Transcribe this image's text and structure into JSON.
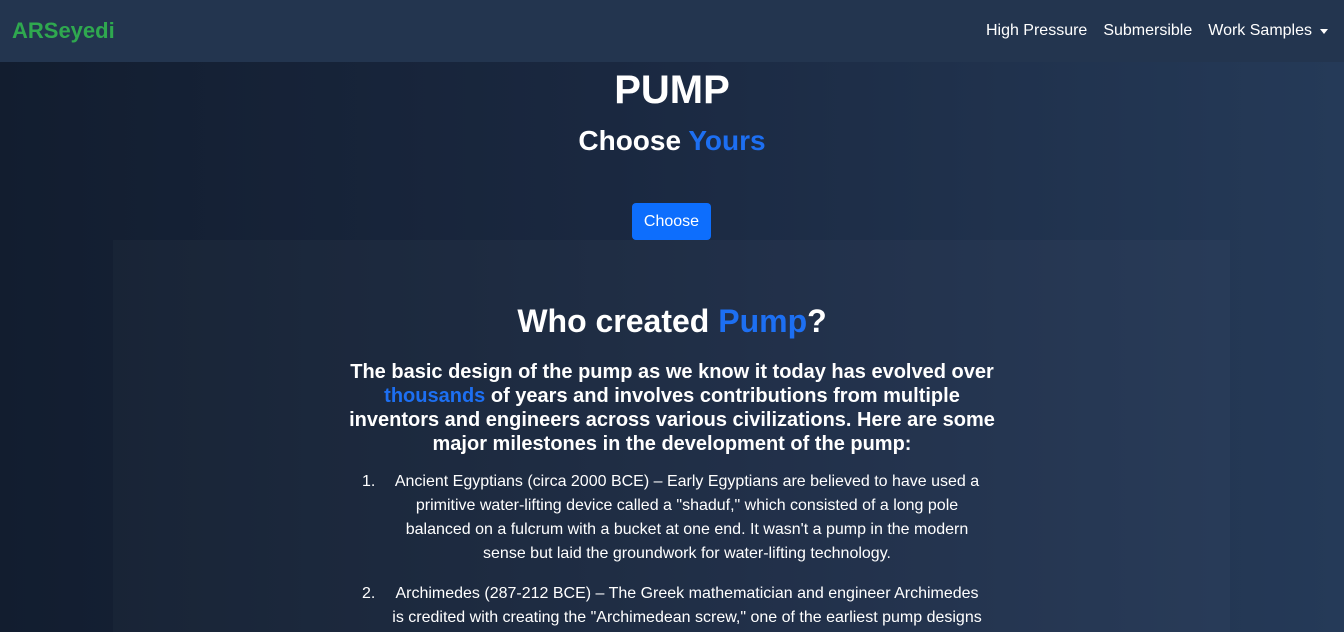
{
  "navbar": {
    "brand": "ARSeyedi",
    "links": [
      "High Pressure",
      "Submersible",
      "Work Samples"
    ]
  },
  "hero": {
    "title": "PUMP",
    "subtitle_prefix": "Choose ",
    "subtitle_accent": "Yours",
    "button_label": "Choose"
  },
  "section": {
    "heading_prefix": "Who created ",
    "heading_accent": "Pump",
    "heading_suffix": "?",
    "intro_prefix": "The basic design of the pump as we know it today has evolved over ",
    "intro_accent": "thousands",
    "intro_suffix": " of years and involves contributions from multiple inventors and engineers across various civilizations. Here are some major milestones in the development of the pump:",
    "milestones": [
      {
        "num": "1.",
        "text": "Ancient Egyptians (circa 2000 BCE) – Early Egyptians are believed to have used a primitive water-lifting device called a \"shaduf,\" which consisted of a long pole balanced on a fulcrum with a bucket at one end. It wasn't a pump in the modern sense but laid the groundwork for water-lifting technology."
      },
      {
        "num": "2.",
        "text": "Archimedes (287-212 BCE) – The Greek mathematician and engineer Archimedes is credited with creating the \"Archimedean screw,\" one of the earliest pump designs"
      }
    ]
  },
  "colors": {
    "accent": "#1d6ff2",
    "brand": "#2fa84f",
    "button": "#0d6efd",
    "navbar": "#23354f"
  }
}
